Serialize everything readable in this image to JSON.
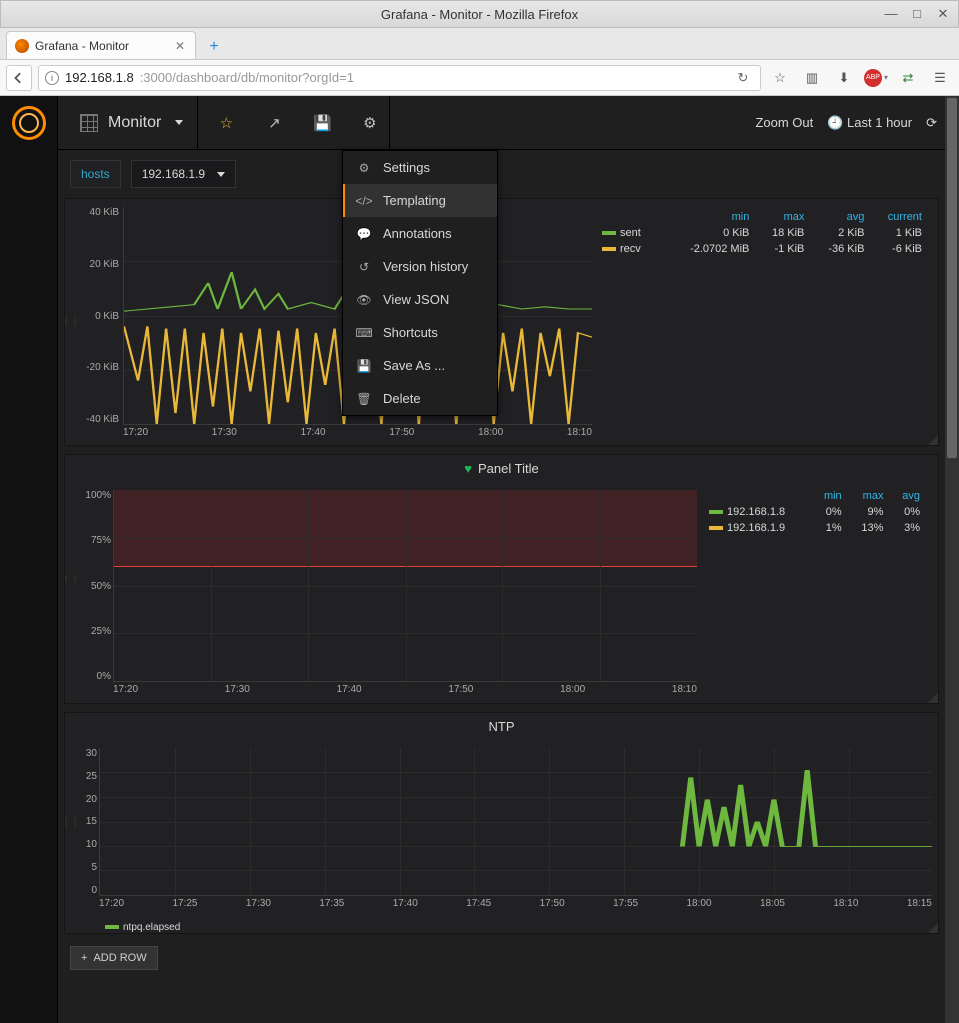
{
  "window": {
    "title": "Grafana - Monitor - Mozilla Firefox"
  },
  "tab": {
    "title": "Grafana - Monitor"
  },
  "url": {
    "host": "192.168.1.8",
    "rest": ":3000/dashboard/db/monitor?orgId=1"
  },
  "topbar": {
    "dashboard": "Monitor",
    "zoom_out": "Zoom Out",
    "time_range": "Last 1 hour"
  },
  "variables": {
    "label": "hosts",
    "value": "192.168.1.9"
  },
  "menu": {
    "items": [
      {
        "icon": "gear",
        "label": "Settings"
      },
      {
        "icon": "code",
        "label": "Templating",
        "active": true
      },
      {
        "icon": "comment",
        "label": "Annotations"
      },
      {
        "icon": "history",
        "label": "Version history"
      },
      {
        "icon": "eye",
        "label": "View JSON"
      },
      {
        "icon": "keyboard",
        "label": "Shortcuts"
      },
      {
        "icon": "save",
        "label": "Save As ..."
      },
      {
        "icon": "trash",
        "label": "Delete"
      }
    ]
  },
  "panel1": {
    "yticks": [
      "40 KiB",
      "20 KiB",
      "0 KiB",
      "-20 KiB",
      "-40 KiB"
    ],
    "xticks": [
      "17:20",
      "17:30",
      "17:40",
      "17:50",
      "18:00",
      "18:10"
    ],
    "headers": [
      "min",
      "max",
      "avg",
      "current"
    ],
    "rows": [
      {
        "color": "#6eb83f",
        "name": "sent",
        "min": "0 KiB",
        "max": "18 KiB",
        "avg": "2 KiB",
        "current": "1 KiB"
      },
      {
        "color": "#eab839",
        "name": "recv",
        "min": "-2.0702 MiB",
        "max": "-1 KiB",
        "avg": "-36 KiB",
        "current": "-6 KiB"
      }
    ]
  },
  "panel2": {
    "title": "Panel Title",
    "yticks": [
      "100%",
      "75%",
      "50%",
      "25%",
      "0%"
    ],
    "xticks": [
      "17:20",
      "17:30",
      "17:40",
      "17:50",
      "18:00",
      "18:10"
    ],
    "headers": [
      "min",
      "max",
      "avg"
    ],
    "rows": [
      {
        "color": "#6eb83f",
        "name": "192.168.1.8",
        "min": "0%",
        "max": "9%",
        "avg": "0%"
      },
      {
        "color": "#eab839",
        "name": "192.168.1.9",
        "min": "1%",
        "max": "13%",
        "avg": "3%"
      }
    ]
  },
  "panel3": {
    "title": "NTP",
    "yticks": [
      "30",
      "25",
      "20",
      "15",
      "10",
      "5",
      "0"
    ],
    "xticks": [
      "17:20",
      "17:25",
      "17:30",
      "17:35",
      "17:40",
      "17:45",
      "17:50",
      "17:55",
      "18:00",
      "18:05",
      "18:10",
      "18:15"
    ],
    "series": {
      "color": "#6eb83f",
      "name": "ntpq.elapsed"
    }
  },
  "addrow": "ADD ROW",
  "chart_data": [
    {
      "type": "line",
      "panel": 1,
      "x": [
        "17:20",
        "17:30",
        "17:40",
        "17:50",
        "18:00",
        "18:10"
      ],
      "ylim": [
        -40,
        40
      ],
      "yunit": "KiB",
      "series": [
        {
          "name": "sent",
          "color": "#6eb83f",
          "stats": {
            "min": 0,
            "max": 18,
            "avg": 2,
            "current": 1
          },
          "unit": "KiB"
        },
        {
          "name": "recv",
          "color": "#eab839",
          "stats": {
            "min": -2121,
            "max": -1,
            "avg": -36,
            "current": -6
          },
          "unit": "KiB"
        }
      ]
    },
    {
      "type": "line",
      "panel": 2,
      "title": "Panel Title",
      "x": [
        "17:20",
        "17:30",
        "17:40",
        "17:50",
        "18:00",
        "18:10"
      ],
      "ylim": [
        0,
        100
      ],
      "yunit": "%",
      "threshold_band": [
        60,
        100
      ],
      "threshold_line": 60,
      "series": [
        {
          "name": "192.168.1.8",
          "color": "#6eb83f",
          "stats": {
            "min": 0,
            "max": 9,
            "avg": 0
          }
        },
        {
          "name": "192.168.1.9",
          "color": "#eab839",
          "stats": {
            "min": 1,
            "max": 13,
            "avg": 3
          }
        }
      ]
    },
    {
      "type": "line",
      "panel": 3,
      "title": "NTP",
      "x": [
        "17:20",
        "17:25",
        "17:30",
        "17:35",
        "17:40",
        "17:45",
        "17:50",
        "17:55",
        "18:00",
        "18:05",
        "18:10",
        "18:15"
      ],
      "ylim": [
        0,
        30
      ],
      "series": [
        {
          "name": "ntpq.elapsed",
          "color": "#6eb83f",
          "approx_values_after_1800": [
            10,
            25,
            8,
            20,
            10,
            18,
            10,
            12,
            10,
            25,
            10,
            10,
            10,
            10
          ]
        }
      ]
    }
  ]
}
